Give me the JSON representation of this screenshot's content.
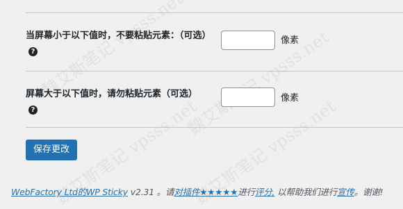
{
  "settings": {
    "row1": {
      "label": "当屏幕小于以下值时，不要粘贴元素：（可选）",
      "help_icon": "?",
      "input_value": "",
      "unit": "像素"
    },
    "row2": {
      "label": "屏幕大于以下值时，请勿粘贴元素（可选）",
      "help_icon": "?",
      "input_value": "",
      "unit": "像素"
    }
  },
  "save_button": "保存更改",
  "footer": {
    "author_link": "WebFactory Ltd的WP Sticky",
    "version": " v2.31 。请",
    "rate_link": "对插件★★★★★",
    "text_mid": "进行",
    "review_link": "评分,",
    "text_mid2": " 以帮助我们进行",
    "promote_link": "宣传",
    "text_end": "。谢谢!"
  },
  "watermark": {
    "text": "魏艾斯笔记 vpsss.net"
  }
}
